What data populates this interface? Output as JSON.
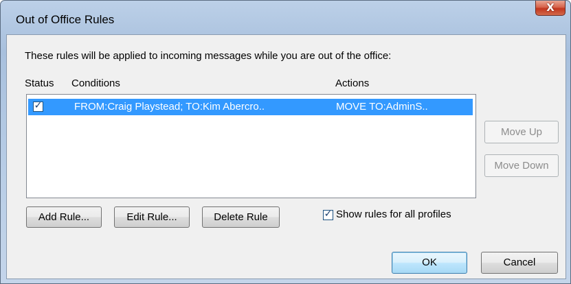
{
  "window": {
    "title": "Out of Office Rules",
    "close_label": "X"
  },
  "dialog": {
    "description": "These rules will be applied to incoming messages while you are out of the office:",
    "columns": {
      "status": "Status",
      "conditions": "Conditions",
      "actions": "Actions"
    },
    "rules": [
      {
        "checked": true,
        "check_glyph": "✓",
        "conditions": "FROM:Craig Playstead; TO:Kim Abercro..",
        "actions": "MOVE TO:AdminS..",
        "selected": true
      }
    ],
    "buttons": {
      "move_up": "Move Up",
      "move_down": "Move Down",
      "add_rule": "Add Rule...",
      "edit_rule": "Edit Rule...",
      "delete_rule": "Delete Rule",
      "ok": "OK",
      "cancel": "Cancel"
    },
    "show_all_profiles": {
      "checked": true,
      "check_glyph": "✓",
      "label": "Show rules for all profiles"
    }
  },
  "colors": {
    "selection": "#3399ff",
    "close_button": "#c2361e",
    "titlebar": "#b8cde6"
  }
}
